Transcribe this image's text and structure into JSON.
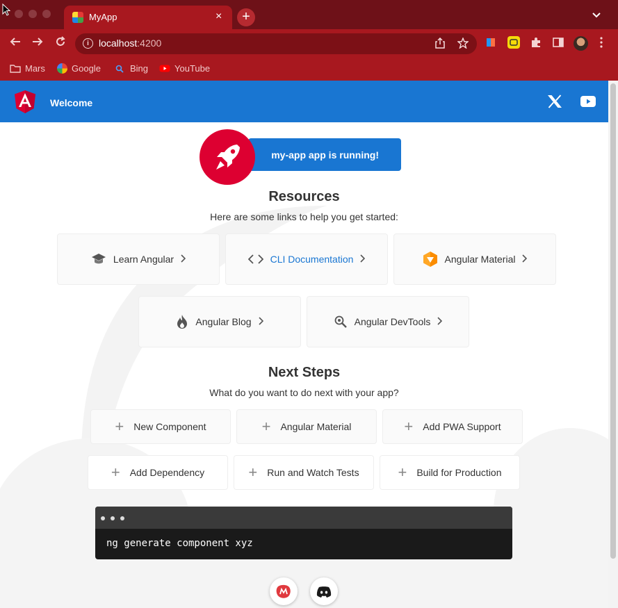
{
  "browser": {
    "tab_title": "MyApp",
    "tab_close": "×",
    "new_tab": "+",
    "url_host": "localhost",
    "url_port": ":4200",
    "bookmarks": [
      {
        "label": "Mars",
        "icon": "folder-icon"
      },
      {
        "label": "Google",
        "icon": "google-icon"
      },
      {
        "label": "Bing",
        "icon": "bing-icon"
      },
      {
        "label": "YouTube",
        "icon": "youtube-icon"
      }
    ]
  },
  "header": {
    "title": "Welcome"
  },
  "banner": {
    "running_text": "my-app app is running!"
  },
  "resources": {
    "title": "Resources",
    "subtitle": "Here are some links to help you get started:",
    "cards": [
      {
        "label": "Learn Angular",
        "icon": "graduation-cap-icon"
      },
      {
        "label": "CLI Documentation",
        "icon": "code-brackets-icon"
      },
      {
        "label": "Angular Material",
        "icon": "material-logo-icon"
      },
      {
        "label": "Angular Blog",
        "icon": "flame-icon"
      },
      {
        "label": "Angular DevTools",
        "icon": "magnifier-icon"
      }
    ]
  },
  "next_steps": {
    "title": "Next Steps",
    "subtitle": "What do you want to do next with your app?",
    "buttons": [
      {
        "label": "New Component"
      },
      {
        "label": "Angular Material"
      },
      {
        "label": "Add PWA Support"
      },
      {
        "label": "Add Dependency"
      },
      {
        "label": "Run and Watch Tests"
      },
      {
        "label": "Build for Production"
      }
    ]
  },
  "terminal": {
    "command": "ng generate component xyz"
  },
  "colors": {
    "angular_red": "#dd0031",
    "primary_blue": "#1976d2",
    "browser_red": "#a8181f"
  }
}
